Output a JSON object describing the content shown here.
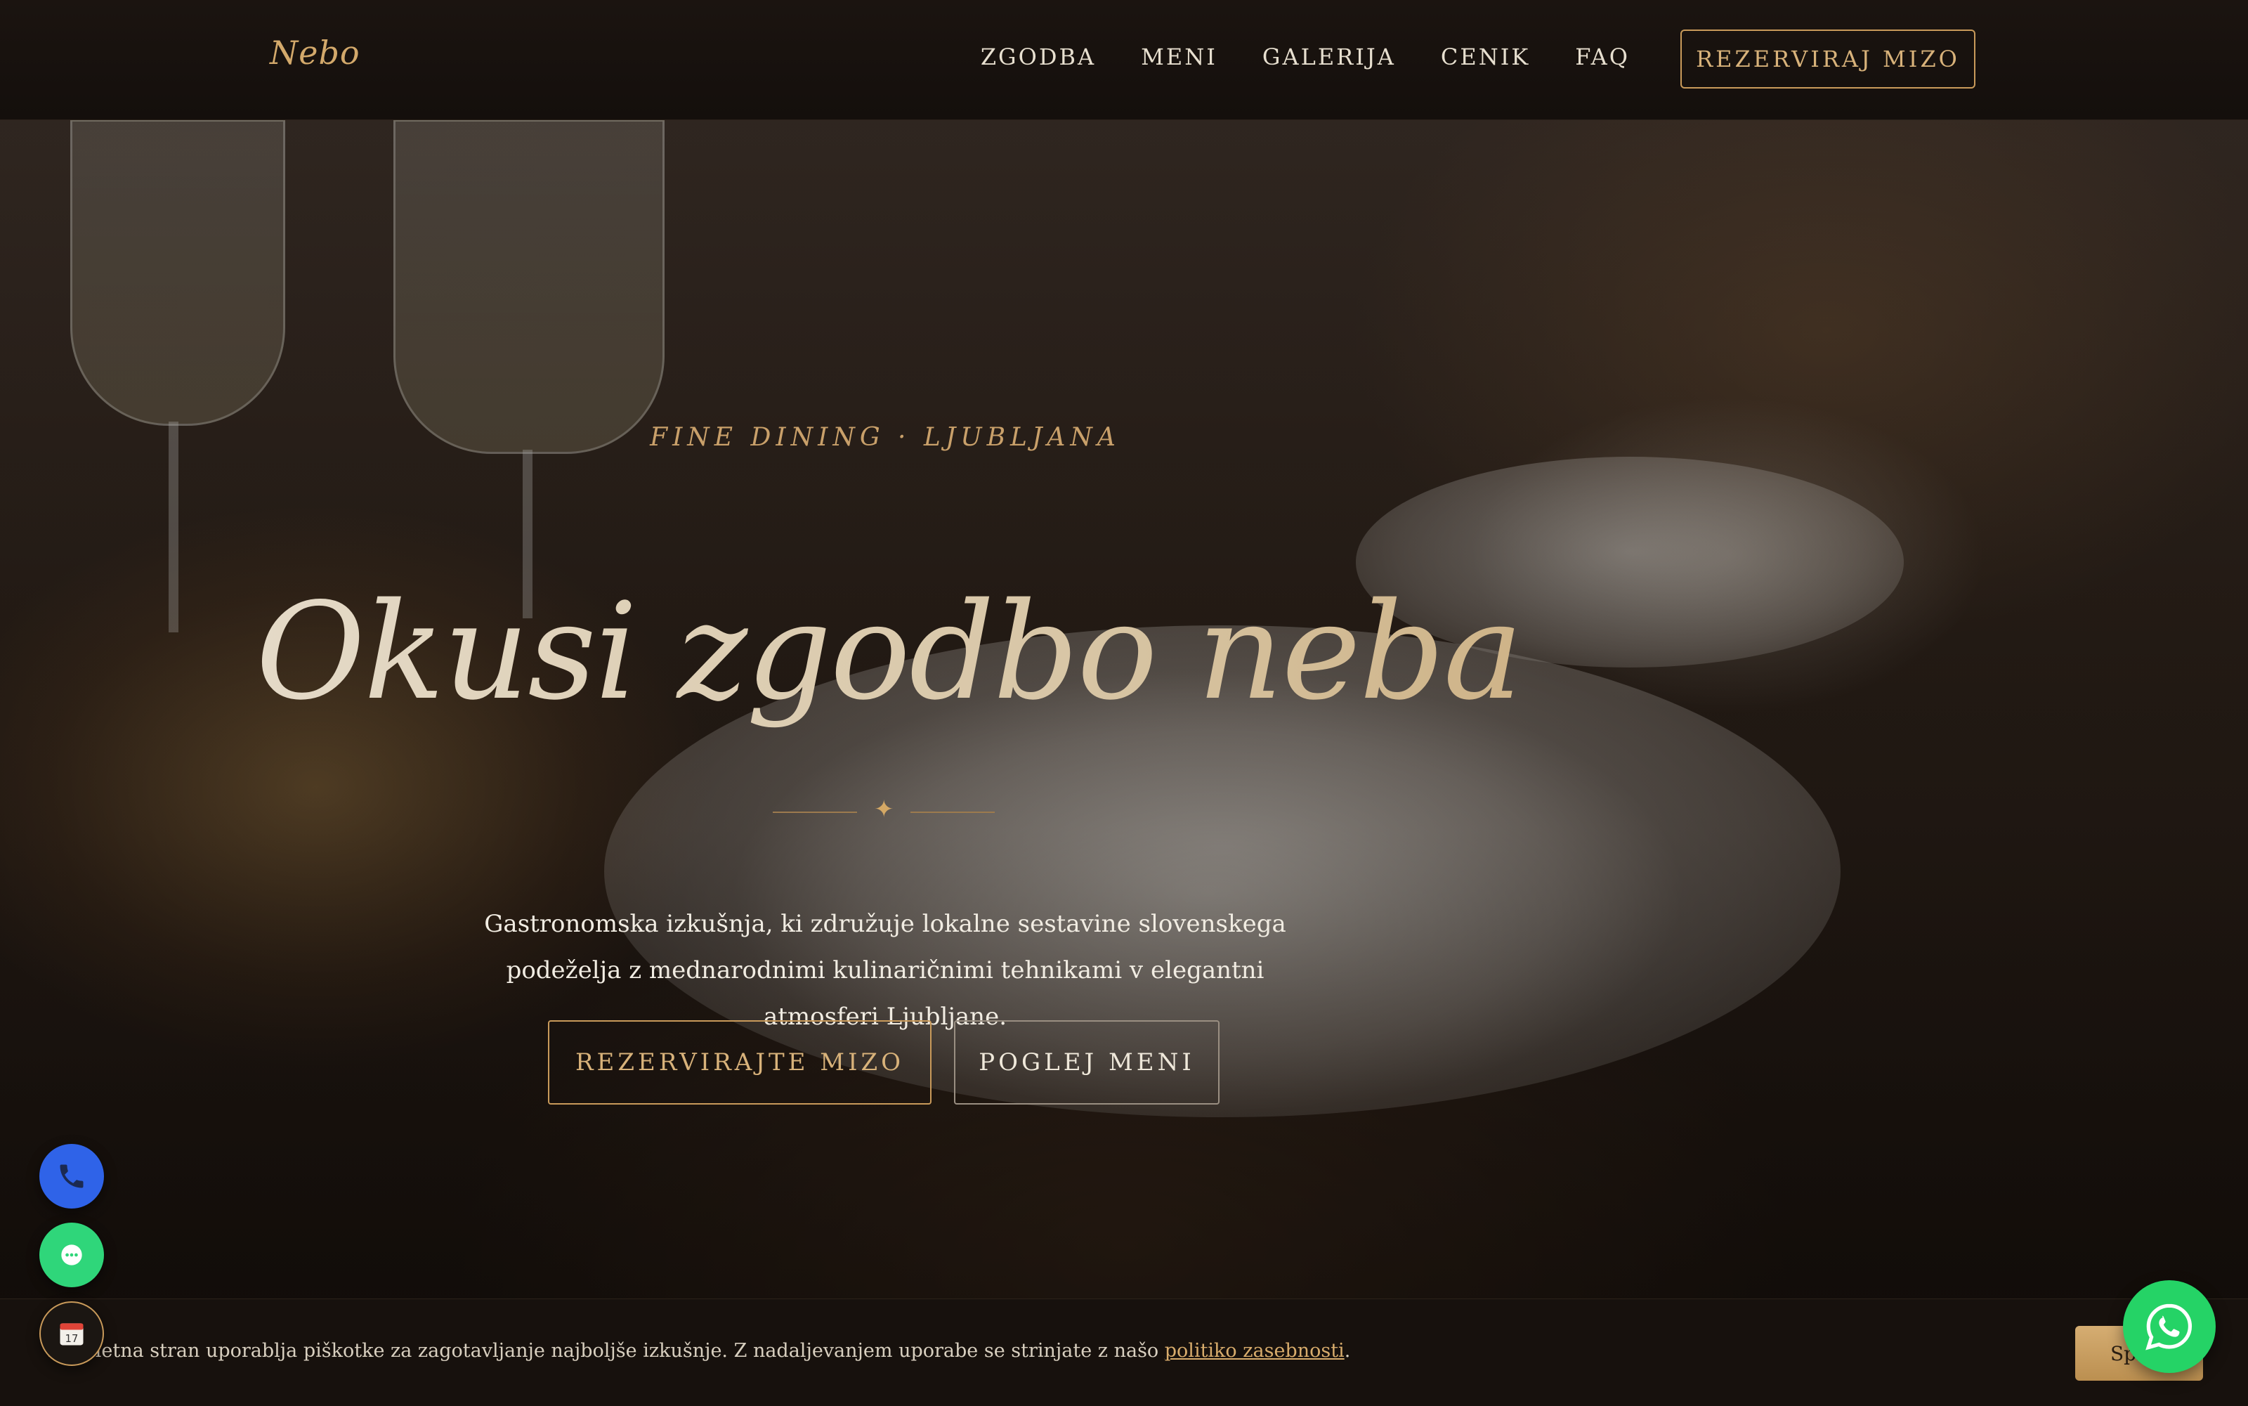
{
  "header": {
    "logo": "Nebo",
    "nav": [
      "ZGODBA",
      "MENI",
      "GALERIJA",
      "CENIK",
      "FAQ"
    ],
    "cta": "REZERVIRAJ MIZO"
  },
  "hero": {
    "eyebrow": "FINE DINING · LJUBLJANA",
    "title": "Okusi zgodbo neba",
    "divider_glyph": "✦",
    "subtitle": "Gastronomska izkušnja, ki združuje lokalne sestavine slovenskega podeželja z mednarodnimi kulinaričnimi tehnikami v elegantni atmosferi Ljubljane.",
    "primary_button": "REZERVIRAJTE MIZO",
    "secondary_button": "POGLEJ MENI"
  },
  "floating": {
    "phone_icon": "phone-icon",
    "chat_icon": "chat-icon",
    "calendar_icon": "calendar-icon",
    "calendar_day": "17",
    "whatsapp_icon": "whatsapp-icon"
  },
  "cookie": {
    "text": "Ta spletna stran uporablja piškotke za zagotavljanje najboljše izkušnje. Z nadaljevanjem uporabe se strinjate z našo ",
    "link": "politiko zasebnosti",
    "end": ".",
    "accept": "Sprejmi"
  },
  "colors": {
    "accent": "#c99a5a",
    "background": "#120d0a",
    "phone": "#2f63e8",
    "chat": "#2fd67a",
    "whatsapp": "#25d366"
  }
}
